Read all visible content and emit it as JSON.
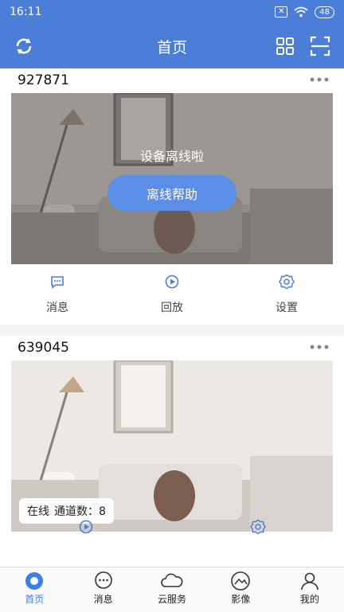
{
  "status_bar": {
    "time": "16:11",
    "battery": "48"
  },
  "app_bar": {
    "title": "首页"
  },
  "devices": [
    {
      "id": "927871",
      "offline_text": "设备离线啦",
      "help_button": "离线帮助",
      "actions": [
        "消息",
        "回放",
        "设置"
      ]
    },
    {
      "id": "639045",
      "status": "在线",
      "channels_label": "通道数：8"
    }
  ],
  "bottom_nav": {
    "items": [
      "首页",
      "消息",
      "云服务",
      "影像",
      "我的"
    ],
    "active": "首页"
  },
  "colors": {
    "primary": "#4a7ed9",
    "accent": "#3d7ee6",
    "button": "#5b8ee6"
  }
}
